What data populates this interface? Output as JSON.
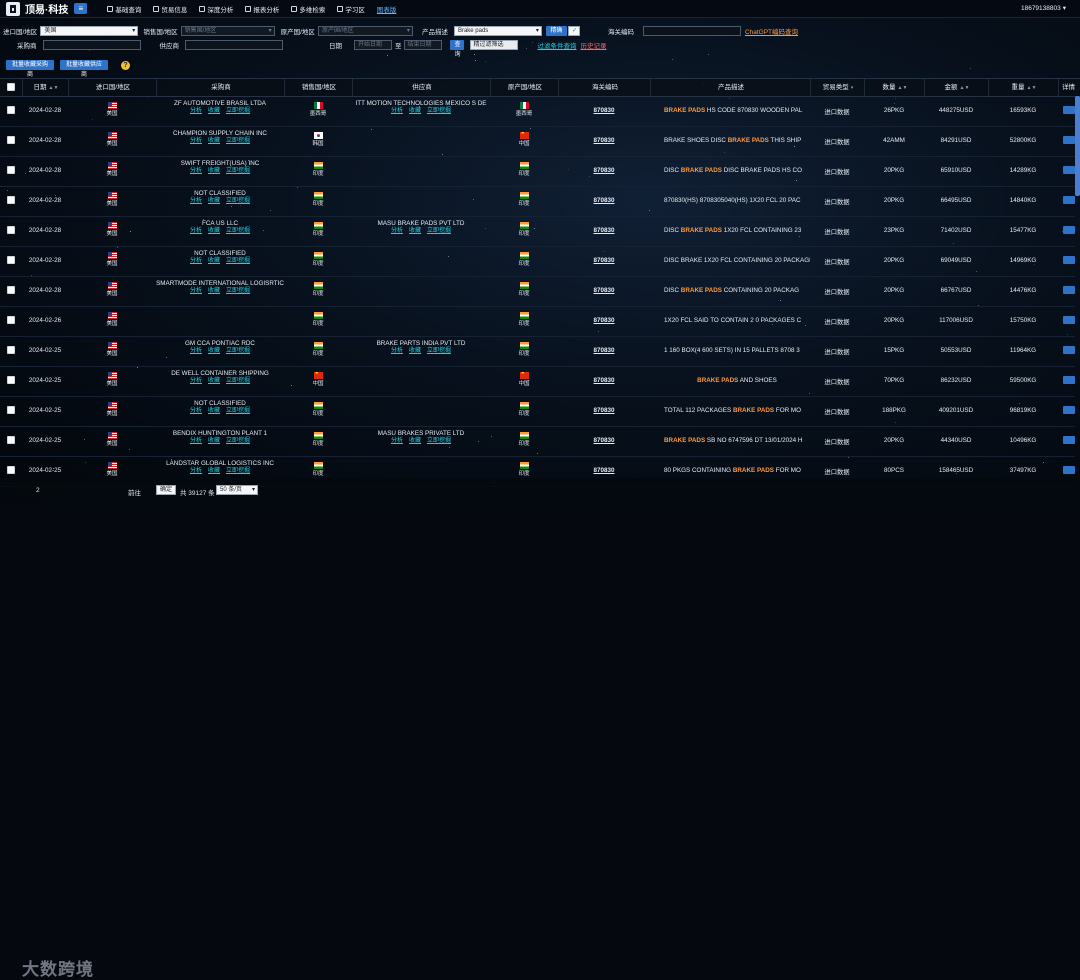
{
  "nav": {
    "brand": "顶易·科技",
    "items": [
      "基础查询",
      "贸易信息",
      "深度分析",
      "报表分析",
      "多维检索",
      "学习区",
      "图表版"
    ],
    "phone": "18679138803"
  },
  "filters": {
    "import_country": {
      "label": "进口国/地区",
      "value": "美国"
    },
    "sales_country": {
      "label": "销售国/地区",
      "placeholder": "销售国/地区"
    },
    "origin_country": {
      "label": "原产国/地区",
      "placeholder": "原产国/地区"
    },
    "product": {
      "label": "产品描述",
      "value": "Brake pads",
      "exact_label": "精确"
    },
    "hs_code": {
      "label": "海关编码",
      "chatgpt_link": "ChatGPT编码查询"
    },
    "buyer": {
      "label": "采购商"
    },
    "supplier": {
      "label": "供应商"
    },
    "date": {
      "label": "日期",
      "start_placeholder": "开始日期",
      "to": "至",
      "end_placeholder": "结束日期"
    },
    "search_label": "查询",
    "toggle_label": "精过滤筛选",
    "filter_link": "过滤条件查询",
    "history_link": "历史记录"
  },
  "actions": {
    "fav_buyers": "批量收藏采购商",
    "fav_suppliers": "批量收藏供应商"
  },
  "table": {
    "headers": [
      "日期",
      "进口国/地区",
      "采购商",
      "销售国/地区",
      "供应商",
      "原产国/地区",
      "海关编码",
      "产品描述",
      "贸易类型",
      "数量",
      "金额",
      "重量",
      "详情"
    ],
    "action_labels": [
      "分析",
      "收藏",
      "立即挖掘"
    ],
    "rows": [
      {
        "date": "2024-02-28",
        "import": "美国",
        "buyer": "ZF AUTOMOTIVE BRASIL LTDA",
        "sales": "墨西哥",
        "sales_flag": "MX",
        "supplier": "ITT MOTION TECHNOLOGIES MEXICO S DE",
        "origin": "墨西哥",
        "origin_flag": "MX",
        "hs": "870830",
        "desc_pre": "",
        "desc_kw": "BRAKE PADS",
        "desc_post": " HS CODE 870830 WOODEN PAL",
        "type": "进口数据",
        "qty": "26PKG",
        "amount": "448275USD",
        "weight": "16593KG",
        "buyer_actions": true,
        "supplier_actions": true
      },
      {
        "date": "2024-02-28",
        "import": "美国",
        "buyer": "CHAMPION SUPPLY CHAIN INC",
        "sales": "韩国",
        "sales_flag": "KR",
        "supplier": "",
        "origin": "中国",
        "origin_flag": "CN",
        "hs": "870830",
        "desc_pre": "BRAKE SHOES DISC ",
        "desc_kw": "BRAKE PADS",
        "desc_post": " THIS SHIP",
        "type": "进口数据",
        "qty": "42AMM",
        "amount": "84291USD",
        "weight": "52800KG",
        "buyer_actions": true,
        "supplier_actions": false
      },
      {
        "date": "2024-02-28",
        "import": "美国",
        "buyer": "SWIFT FREIGHT(USA) INC",
        "sales": "印度",
        "sales_flag": "IN",
        "supplier": "",
        "origin": "印度",
        "origin_flag": "IN",
        "hs": "870830",
        "desc_pre": "DISC ",
        "desc_kw": "BRAKE PADS",
        "desc_post": " DISC BRAKE PADS HS CO",
        "type": "进口数据",
        "qty": "20PKG",
        "amount": "65910USD",
        "weight": "14289KG",
        "buyer_actions": true,
        "supplier_actions": false
      },
      {
        "date": "2024-02-28",
        "import": "美国",
        "buyer": "NOT CLASSIFIED",
        "sales": "印度",
        "sales_flag": "IN",
        "supplier": "",
        "origin": "印度",
        "origin_flag": "IN",
        "hs": "870830",
        "desc_pre": "870830(HS) 8708305040(HS) 1X20 FCL 20 PAC",
        "desc_kw": "",
        "desc_post": "",
        "type": "进口数据",
        "qty": "20PKG",
        "amount": "66495USD",
        "weight": "14840KG",
        "buyer_actions": true,
        "supplier_actions": false
      },
      {
        "date": "2024-02-28",
        "import": "美国",
        "buyer": "FCA US LLC",
        "sales": "印度",
        "sales_flag": "IN",
        "supplier": "MASU BRAKE PADS PVT LTD",
        "origin": "印度",
        "origin_flag": "IN",
        "hs": "870830",
        "desc_pre": "DISC ",
        "desc_kw": "BRAKE PADS",
        "desc_post": " 1X20 FCL CONTAINING 23",
        "type": "进口数据",
        "qty": "23PKG",
        "amount": "71402USD",
        "weight": "15477KG",
        "buyer_actions": true,
        "supplier_actions": true
      },
      {
        "date": "2024-02-28",
        "import": "美国",
        "buyer": "NOT CLASSIFIED",
        "sales": "印度",
        "sales_flag": "IN",
        "supplier": "",
        "origin": "印度",
        "origin_flag": "IN",
        "hs": "870830",
        "desc_pre": "DISC BRAKE 1X20 FCL CONTAINING 20 PACKAGE",
        "desc_kw": "",
        "desc_post": "",
        "type": "进口数据",
        "qty": "20PKG",
        "amount": "69049USD",
        "weight": "14969KG",
        "buyer_actions": true,
        "supplier_actions": false
      },
      {
        "date": "2024-02-28",
        "import": "美国",
        "buyer": "SMARTMODE INTERNATIONAL LOGISRTIC",
        "sales": "印度",
        "sales_flag": "IN",
        "supplier": "",
        "origin": "印度",
        "origin_flag": "IN",
        "hs": "870830",
        "desc_pre": "DISC ",
        "desc_kw": "BRAKE PADS",
        "desc_post": " CONTAINING 20 PACKAG",
        "type": "进口数据",
        "qty": "20PKG",
        "amount": "66767USD",
        "weight": "14476KG",
        "buyer_actions": true,
        "supplier_actions": false
      },
      {
        "date": "2024-02-26",
        "import": "美国",
        "buyer": "",
        "sales": "印度",
        "sales_flag": "IN",
        "supplier": "",
        "origin": "印度",
        "origin_flag": "IN",
        "hs": "870830",
        "desc_pre": "1X20 FCL SAID TO CONTAIN 2 0 PACKAGES C",
        "desc_kw": "",
        "desc_post": "",
        "type": "进口数据",
        "qty": "20PKG",
        "amount": "117006USD",
        "weight": "15750KG",
        "buyer_actions": false,
        "supplier_actions": false
      },
      {
        "date": "2024-02-25",
        "import": "美国",
        "buyer": "GM CCA PONTIAC RDC",
        "sales": "印度",
        "sales_flag": "IN",
        "supplier": "BRAKE PARTS INDIA PVT LTD",
        "origin": "印度",
        "origin_flag": "IN",
        "hs": "870830",
        "desc_pre": "1 160 BOX(4 600 SETS) IN 15 PALLETS 8708 3",
        "desc_kw": "",
        "desc_post": "",
        "type": "进口数据",
        "qty": "15PKG",
        "amount": "50553USD",
        "weight": "11964KG",
        "buyer_actions": true,
        "supplier_actions": true
      },
      {
        "date": "2024-02-25",
        "import": "美国",
        "buyer": "DE WELL CONTAINER SHIPPING",
        "sales": "中国",
        "sales_flag": "CN",
        "supplier": "",
        "origin": "中国",
        "origin_flag": "CN",
        "hs": "870830",
        "desc_pre": "",
        "desc_kw": "BRAKE PADS",
        "desc_post": " AND SHOES",
        "type": "进口数据",
        "qty": "70PKG",
        "amount": "86232USD",
        "weight": "59500KG",
        "buyer_actions": true,
        "supplier_actions": false,
        "desc_center": true
      },
      {
        "date": "2024-02-25",
        "import": "美国",
        "buyer": "NOT CLASSIFIED",
        "sales": "印度",
        "sales_flag": "IN",
        "supplier": "",
        "origin": "印度",
        "origin_flag": "IN",
        "hs": "870830",
        "desc_pre": "TOTAL 112 PACKAGES ",
        "desc_kw": "BRAKE PADS",
        "desc_post": " FOR MO",
        "type": "进口数据",
        "qty": "188PKG",
        "amount": "409201USD",
        "weight": "96819KG",
        "buyer_actions": true,
        "supplier_actions": false
      },
      {
        "date": "2024-02-25",
        "import": "美国",
        "buyer": "BENDIX HUNTINGTON PLANT 1",
        "sales": "印度",
        "sales_flag": "IN",
        "supplier": "MASU BRAKES PRIVATE LTD",
        "origin": "印度",
        "origin_flag": "IN",
        "hs": "870830",
        "desc_pre": "",
        "desc_kw": "BRAKE PADS",
        "desc_post": " SB NO 6747596 DT 13/01/2024 H",
        "type": "进口数据",
        "qty": "20PKG",
        "amount": "44340USD",
        "weight": "10496KG",
        "buyer_actions": true,
        "supplier_actions": true
      },
      {
        "date": "2024-02-25",
        "import": "美国",
        "buyer": "LANDSTAR GLOBAL LOGISTICS INC",
        "sales": "印度",
        "sales_flag": "IN",
        "supplier": "",
        "origin": "印度",
        "origin_flag": "IN",
        "hs": "870830",
        "desc_pre": "80 PKGS CONTAINING ",
        "desc_kw": "BRAKE PADS",
        "desc_post": " FOR MO",
        "type": "进口数据",
        "qty": "80PCS",
        "amount": "158465USD",
        "weight": "37497KG",
        "buyer_actions": true,
        "supplier_actions": false
      }
    ]
  },
  "footer": {
    "watermark": "大数跨境",
    "page": "2",
    "goto": "前往",
    "confirm": "确定",
    "total": "共 39127 条",
    "page_size": "50 条/页"
  }
}
